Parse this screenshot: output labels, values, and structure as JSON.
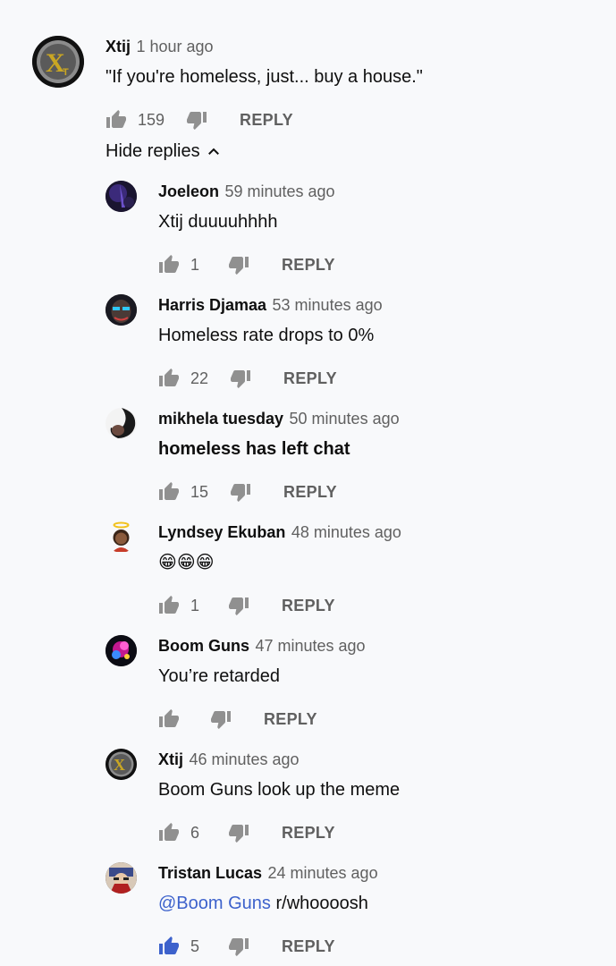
{
  "top_comment": {
    "author": "Xtij",
    "time": "1 hour ago",
    "text": "\"If you're homeless, just... buy a house.\"",
    "likes": "159",
    "reply_label": "REPLY",
    "avatar_icon": "xtij-logo-avatar"
  },
  "hide_replies_label": "Hide replies",
  "replies": [
    {
      "author": "Joeleon",
      "time": "59 minutes ago",
      "text": "Xtij duuuuhhhh",
      "likes": "1",
      "reply_label": "REPLY"
    },
    {
      "author": "Harris Djamaa",
      "time": "53 minutes ago",
      "text": "Homeless rate drops to 0%",
      "likes": "22",
      "reply_label": "REPLY"
    },
    {
      "author": "mikhela tuesday",
      "time": "50 minutes ago",
      "text": "homeless has left chat",
      "likes": "15",
      "reply_label": "REPLY"
    },
    {
      "author": "Lyndsey Ekuban",
      "time": "48 minutes ago",
      "text": "😁😁😁",
      "likes": "1",
      "reply_label": "REPLY"
    },
    {
      "author": "Boom Guns",
      "time": "47 minutes ago",
      "text": "You’re retarded",
      "likes": "",
      "reply_label": "REPLY"
    },
    {
      "author": "Xtij",
      "time": "46 minutes ago",
      "text": "Boom Guns look up the meme",
      "likes": "6",
      "reply_label": "REPLY"
    },
    {
      "author": "Tristan Lucas",
      "time": "24 minutes ago",
      "mention": "@Boom Guns",
      "text": " r/whoooosh",
      "likes": "5",
      "reply_label": "REPLY",
      "liked": true
    }
  ],
  "colors": {
    "background": "#f8f9fb",
    "liked_blue": "#3d62cc",
    "icon_gray": "#909090"
  }
}
